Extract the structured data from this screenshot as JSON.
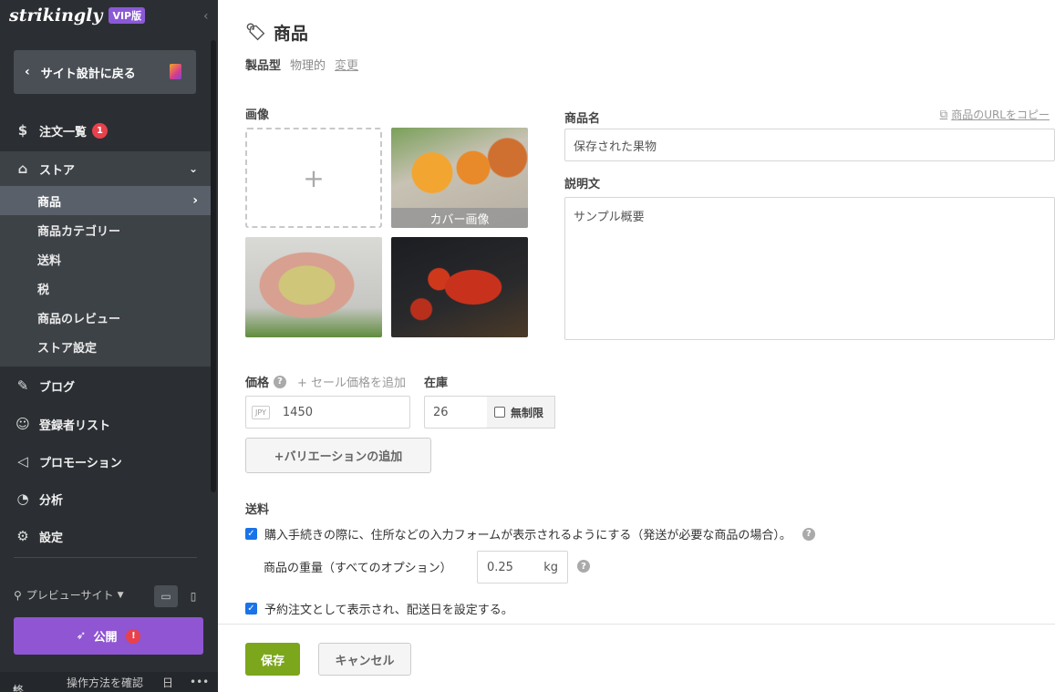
{
  "brand": {
    "logo": "strikingly",
    "vip": "VIP版"
  },
  "sidebar": {
    "back": "サイト設計に戻る",
    "orders": {
      "label": "注文一覧",
      "badge": "1"
    },
    "store": {
      "label": "ストア"
    },
    "store_items": [
      {
        "label": "商品"
      },
      {
        "label": "商品カテゴリー"
      },
      {
        "label": "送料"
      },
      {
        "label": "税"
      },
      {
        "label": "商品のレビュー"
      },
      {
        "label": "ストア設定"
      }
    ],
    "nav": [
      {
        "label": "ブログ",
        "icon": "quill-icon"
      },
      {
        "label": "登録者リスト",
        "icon": "users-icon"
      },
      {
        "label": "プロモーション",
        "icon": "megaphone-icon"
      },
      {
        "label": "分析",
        "icon": "pie-chart-icon"
      },
      {
        "label": "設定",
        "icon": "gear-icon"
      }
    ],
    "preview": "プレビューサイト",
    "publish": "公開",
    "publish_warn": "!",
    "bottom": {
      "exit": "終了",
      "howto": "操作方法を確認",
      "lang": "日",
      "more": "•••"
    }
  },
  "product": {
    "title": "商品",
    "type_label": "製品型",
    "type_value": "物理的",
    "type_change": "変更",
    "images_label": "画像",
    "cover_label": "カバー画像",
    "name_label": "商品名",
    "copy_url": "商品のURLをコピー",
    "name_value": "保存された果物",
    "desc_label": "説明文",
    "desc_value": "サンプル概要",
    "price_label": "価格",
    "add_sale": "+ セール価格を追加",
    "currency": "JPY",
    "price_value": "1450",
    "stock_label": "在庫",
    "stock_value": "26",
    "unlimited": "無制限",
    "variation_btn": "+バリエーションの追加",
    "shipping_label": "送料",
    "shipping_checkbox": "購入手続きの際に、住所などの入力フォームが表示されるようにする（発送が必要な商品の場合）。",
    "weight_label": "商品の重量（すべてのオプション）",
    "weight_value": "0.25",
    "weight_unit": "kg",
    "preorder_checkbox": "予約注文として表示され、配送日を設定する。"
  },
  "footer": {
    "save": "保存",
    "cancel": "キャンセル"
  },
  "colors": {
    "sidebar": "#2b2f33",
    "publish": "#8f55d2",
    "save": "#7ca61c",
    "badge": "#e8414b",
    "checkbox": "#1a73e8"
  }
}
